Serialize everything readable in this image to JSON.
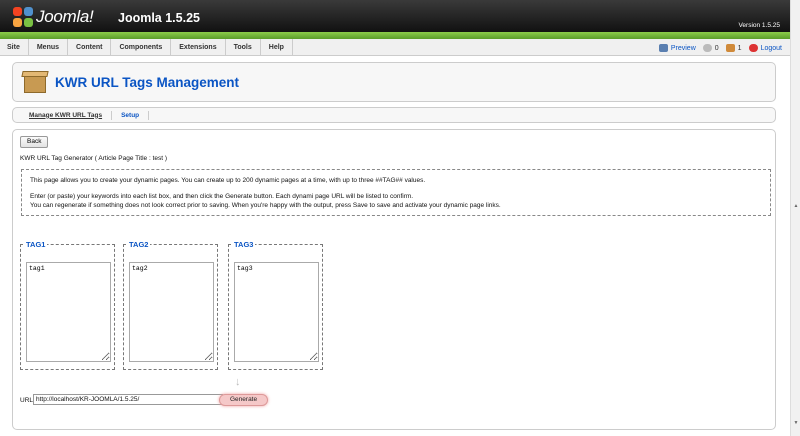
{
  "header": {
    "logo_text": "Joomla!",
    "app_version_title": "Joomla 1.5.25",
    "version_label": "Version 1.5.25"
  },
  "menubar": {
    "items": [
      "Site",
      "Menus",
      "Content",
      "Components",
      "Extensions",
      "Tools",
      "Help"
    ],
    "preview_label": "Preview",
    "messages_count": "0",
    "users_count": "1",
    "logout_label": "Logout"
  },
  "page": {
    "title": "KWR URL Tags Management"
  },
  "subnav": {
    "tabs": [
      "Manage KWR URL Tags",
      "Setup"
    ]
  },
  "content": {
    "back_label": "Back",
    "generator_title": "KWR URL Tag Generator ( Article Page Title : test )",
    "info_line1": "This page allows you to create your dynamic pages. You can create up to 200 dynamic pages at a time, with up to three ##TAG## values.",
    "info_line2": "Enter (or paste) your keywords into each list box, and then click the Generate button. Each dynami page URL will be listed to confirm.",
    "info_line3": "You can regenerate if something does not look correct prior to saving. When you're happy with the output, press Save to save and activate your dynamic page links.",
    "tags": [
      {
        "legend": "TAG1",
        "value": "tag1"
      },
      {
        "legend": "TAG2",
        "value": "tag2"
      },
      {
        "legend": "TAG3",
        "value": "tag3"
      }
    ],
    "url_label": "URL",
    "url_value": "http://localhost/KR-JOOMLA/1.5.25/",
    "generate_label": "Generate"
  },
  "icons": {
    "arrow": "down-arrow-icon",
    "colors": {
      "brand_green": "#6fb23c",
      "link_blue": "#0B55C4"
    }
  }
}
